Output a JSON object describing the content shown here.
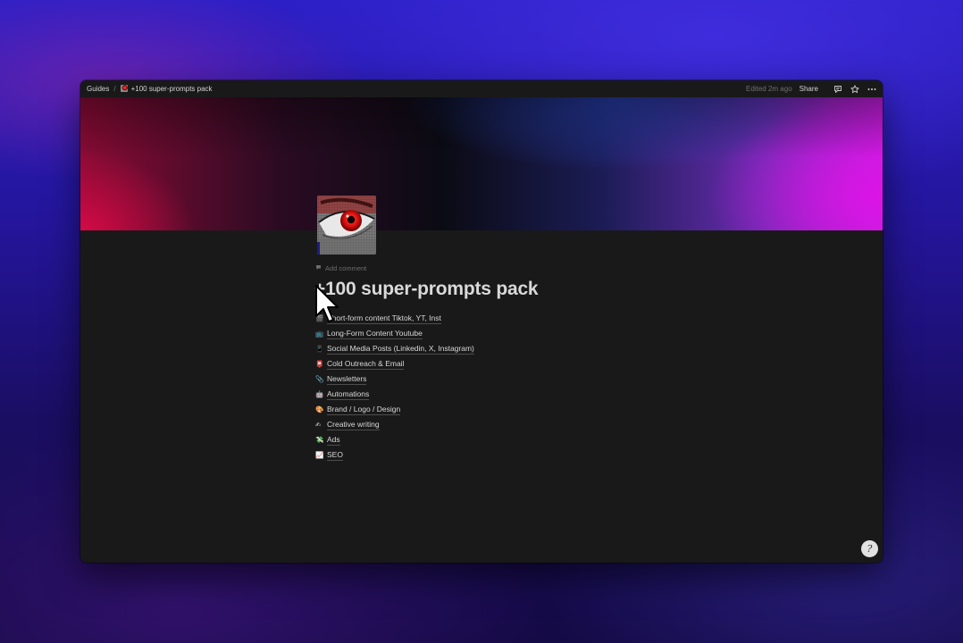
{
  "topbar": {
    "breadcrumb_root": "Guides",
    "breadcrumb_page": "+100 super-prompts pack",
    "edited": "Edited 2m ago",
    "share_label": "Share",
    "icons": [
      "comment-icon",
      "star-icon",
      "more-icon"
    ]
  },
  "page": {
    "add_comment": "Add comment",
    "title": "+100 super-prompts pack",
    "items": [
      {
        "emoji": "🎬",
        "label": "Short-form content Tiktok, YT, Inst"
      },
      {
        "emoji": "📺",
        "label": "Long-Form Content Youtube"
      },
      {
        "emoji": "📱",
        "label": "Social Media Posts (Linkedin, X, Instagram)"
      },
      {
        "emoji": "📮",
        "label": "Cold Outreach & Email"
      },
      {
        "emoji": "📎",
        "label": "Newsletters"
      },
      {
        "emoji": "🤖",
        "label": "Automations"
      },
      {
        "emoji": "🎨",
        "label": "Brand / Logo / Design"
      },
      {
        "emoji": "✍",
        "label": "Creative writing"
      },
      {
        "emoji": "💸",
        "label": "Ads"
      },
      {
        "emoji": "📈",
        "label": "SEO"
      }
    ]
  },
  "help_button": "?",
  "colors": {
    "window_bg": "#191919",
    "text": "#d8d8d8",
    "muted": "#6f6f6f",
    "cover_left": "#d70a46",
    "cover_right": "#c61ee0"
  }
}
